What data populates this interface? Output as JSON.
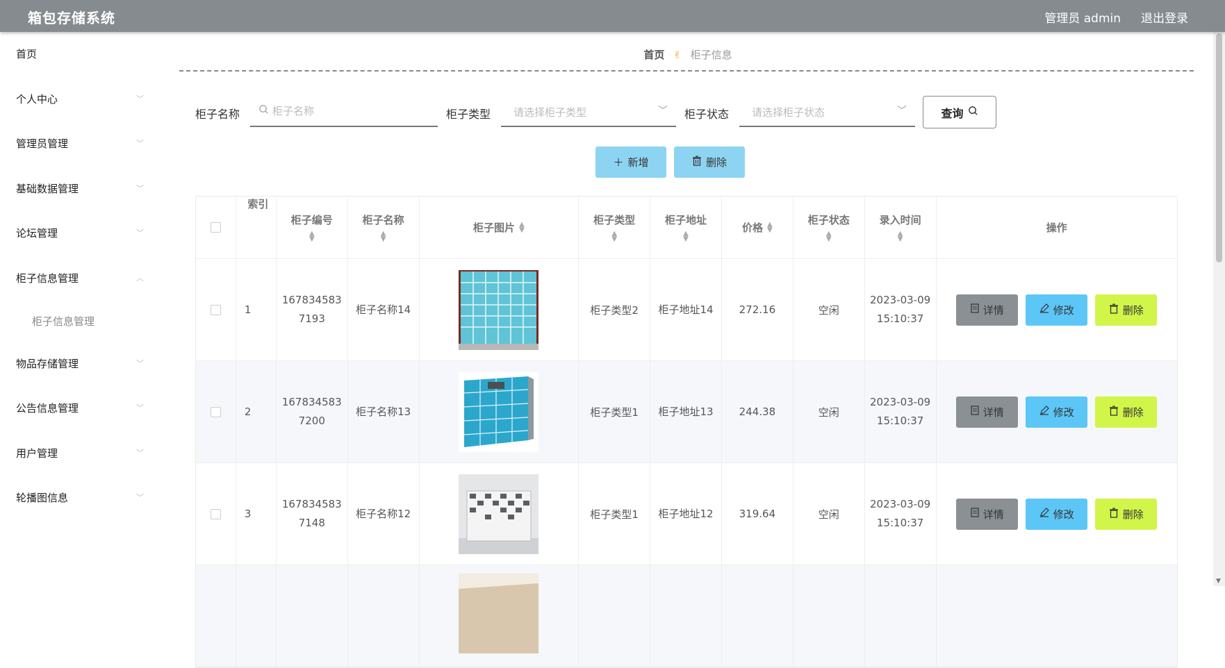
{
  "header": {
    "title": "箱包存储系统",
    "user": "管理员 admin",
    "logout": "退出登录"
  },
  "sidebar": {
    "items": [
      {
        "label": "首页"
      },
      {
        "label": "个人中心"
      },
      {
        "label": "管理员管理"
      },
      {
        "label": "基础数据管理"
      },
      {
        "label": "论坛管理"
      },
      {
        "label": "柜子信息管理"
      },
      {
        "label": "柜子信息管理"
      },
      {
        "label": "物品存储管理"
      },
      {
        "label": "公告信息管理"
      },
      {
        "label": "用户管理"
      },
      {
        "label": "轮播图信息"
      }
    ]
  },
  "breadcrumb": {
    "home": "首页",
    "current": "柜子信息"
  },
  "search": {
    "name_label": "柜子名称",
    "name_placeholder": "柜子名称",
    "type_label": "柜子类型",
    "type_placeholder": "请选择柜子类型",
    "status_label": "柜子状态",
    "status_placeholder": "请选择柜子状态",
    "query_label": "查询"
  },
  "toolbar": {
    "add_label": "新增",
    "delete_label": "删除"
  },
  "table": {
    "headers": {
      "index": "索引",
      "no": "柜子编号",
      "name": "柜子名称",
      "image": "柜子图片",
      "type": "柜子类型",
      "address": "柜子地址",
      "price": "价格",
      "status": "柜子状态",
      "time": "录入时间",
      "ops": "操作"
    },
    "rows": [
      {
        "index": "1",
        "no": "1678345837193",
        "name": "柜子名称14",
        "type": "柜子类型2",
        "address": "柜子地址14",
        "price": "272.16",
        "status": "空闲",
        "time": "2023-03-09 15:10:37"
      },
      {
        "index": "2",
        "no": "1678345837200",
        "name": "柜子名称13",
        "type": "柜子类型1",
        "address": "柜子地址13",
        "price": "244.38",
        "status": "空闲",
        "time": "2023-03-09 15:10:37"
      },
      {
        "index": "3",
        "no": "1678345837148",
        "name": "柜子名称12",
        "type": "柜子类型1",
        "address": "柜子地址12",
        "price": "319.64",
        "status": "空闲",
        "time": "2023-03-09 15:10:37"
      }
    ],
    "ops": {
      "detail": "详情",
      "edit": "修改",
      "delete": "删除"
    }
  }
}
